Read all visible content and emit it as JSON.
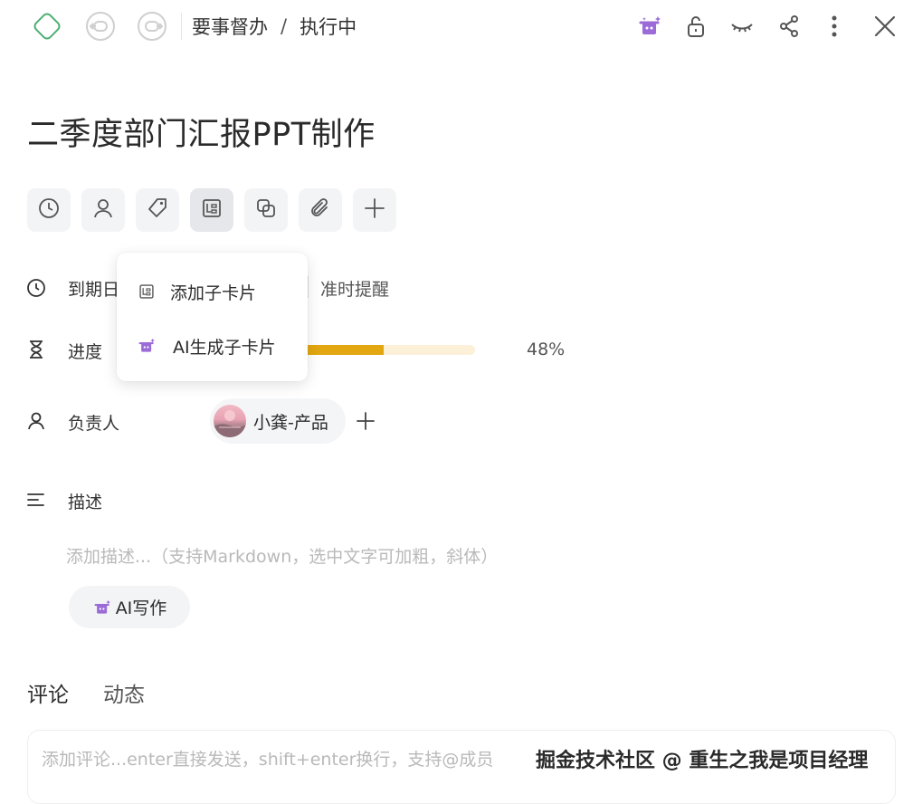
{
  "header": {
    "breadcrumb_parent": "要事督办",
    "breadcrumb_separator": "/",
    "breadcrumb_current": "执行中"
  },
  "task": {
    "title": "二季度部门汇报PPT制作"
  },
  "toolbar": {
    "buttons": [
      "clock-icon",
      "user-icon",
      "tag-icon",
      "subcard-icon",
      "copy-icon",
      "paperclip-icon",
      "plus-icon"
    ]
  },
  "fields": {
    "due_label": "到期日",
    "due_reminder": "准时提醒",
    "progress_label": "进度",
    "progress_value": 0.48,
    "progress_text": "48%",
    "assignee_label": "负责人",
    "assignee_name": "小龚-产品",
    "description_label": "描述",
    "description_placeholder": "添加描述...（支持Markdown，选中文字可加粗，斜体）",
    "ai_write_label": "AI写作"
  },
  "dropdown": {
    "items": [
      {
        "label": "添加子卡片",
        "icon": "subcard-icon"
      },
      {
        "label": "AI生成子卡片",
        "icon": "ai-magic-icon"
      }
    ]
  },
  "tabs": {
    "comments": "评论",
    "activity": "动态"
  },
  "comment": {
    "placeholder": "添加评论...enter直接发送，shift+enter换行，支持@成员"
  },
  "watermark": "掘金技术社区 @ 重生之我是项目经理",
  "colors": {
    "accent_purple": "#9b6bd8",
    "progress_fill": "#e2a711",
    "progress_track": "#fcf1d8",
    "logo_green": "#4caf73"
  }
}
